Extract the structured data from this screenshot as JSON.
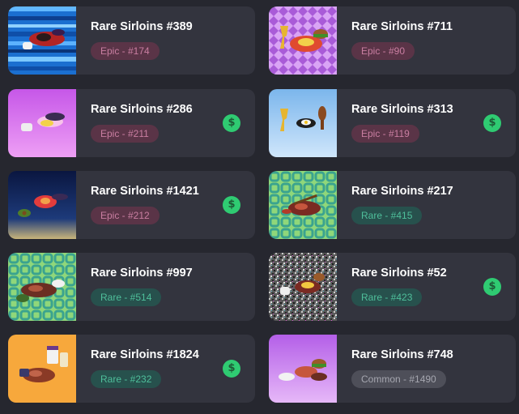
{
  "items": [
    {
      "title": "Rare Sirloins #389",
      "badge": "Epic - #174",
      "rarity": "epic",
      "price_icon": false,
      "price_symbol": "$",
      "art": "blue-stripes"
    },
    {
      "title": "Rare Sirloins #711",
      "badge": "Epic - #90",
      "rarity": "epic",
      "price_icon": false,
      "price_symbol": "$",
      "art": "purple-checks"
    },
    {
      "title": "Rare Sirloins #286",
      "badge": "Epic - #211",
      "rarity": "epic",
      "price_icon": true,
      "price_symbol": "$",
      "art": "magenta-gradient"
    },
    {
      "title": "Rare Sirloins #313",
      "badge": "Epic - #119",
      "rarity": "epic",
      "price_icon": true,
      "price_symbol": "$",
      "art": "sky-gradient"
    },
    {
      "title": "Rare Sirloins #1421",
      "badge": "Epic - #212",
      "rarity": "epic",
      "price_icon": true,
      "price_symbol": "$",
      "art": "night-gradient"
    },
    {
      "title": "Rare Sirloins #217",
      "badge": "Rare - #415",
      "rarity": "rare",
      "price_icon": false,
      "price_symbol": "$",
      "art": "green-chain"
    },
    {
      "title": "Rare Sirloins #997",
      "badge": "Rare - #514",
      "rarity": "rare",
      "price_icon": false,
      "price_symbol": "$",
      "art": "green-chain"
    },
    {
      "title": "Rare Sirloins #52",
      "badge": "Rare - #423",
      "rarity": "rare",
      "price_icon": true,
      "price_symbol": "$",
      "art": "noise"
    },
    {
      "title": "Rare Sirloins #1824",
      "badge": "Rare - #232",
      "rarity": "rare",
      "price_icon": true,
      "price_symbol": "$",
      "art": "orange"
    },
    {
      "title": "Rare Sirloins #748",
      "badge": "Common - #1490",
      "rarity": "common",
      "price_icon": false,
      "price_symbol": "$",
      "art": "violet-gradient"
    }
  ],
  "colors": {
    "background": "#26272f",
    "card": "#33343e",
    "epic_bg": "#5a3447",
    "epic_text": "#c97ea1",
    "rare_bg": "#27514d",
    "rare_text": "#4fbf9b",
    "common_bg": "#4e4f59",
    "common_text": "#a5a6af",
    "price_icon": "#2fcb72"
  }
}
